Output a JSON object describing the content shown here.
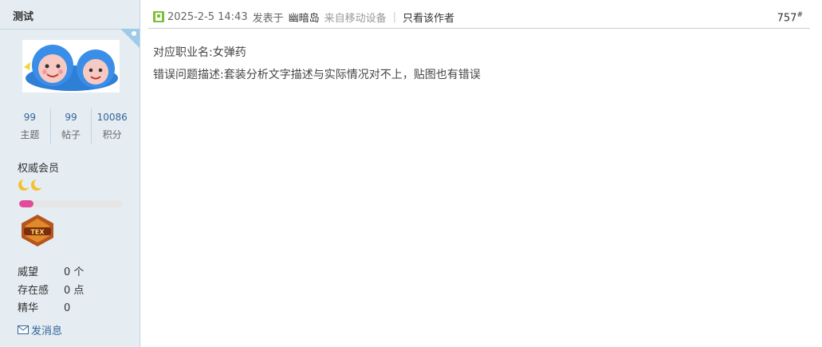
{
  "author_panel": {
    "username": "测试",
    "stats": [
      {
        "value": "99",
        "label": "主题"
      },
      {
        "value": "99",
        "label": "帖子"
      },
      {
        "value": "10086",
        "label": "积分"
      }
    ],
    "user_group": "权威会员",
    "level_progress_percent": 14,
    "progress_color": "#e24a9a",
    "medal_icon": "medal-badge-icon",
    "fields": [
      {
        "key": "威望",
        "value": "0 个"
      },
      {
        "key": "存在感",
        "value": "0 点"
      },
      {
        "key": "精华",
        "value": "0"
      }
    ],
    "send_message_label": "发消息"
  },
  "post": {
    "date": "2025-2-5 14:43",
    "posted_in_label": "发表于",
    "author_name": "幽暗岛",
    "device_text": "来自移动设备",
    "only_author_label": "只看该作者",
    "floor_number": "757",
    "floor_suffix": "#",
    "lines": [
      "对应职业名:女弹药",
      "错误问题描述:套装分析文字描述与实际情况对不上，贴图也有错误"
    ]
  },
  "colors": {
    "sidebar_bg": "#e5edf2",
    "border": "#c2d5e3",
    "link_blue": "#336699"
  }
}
